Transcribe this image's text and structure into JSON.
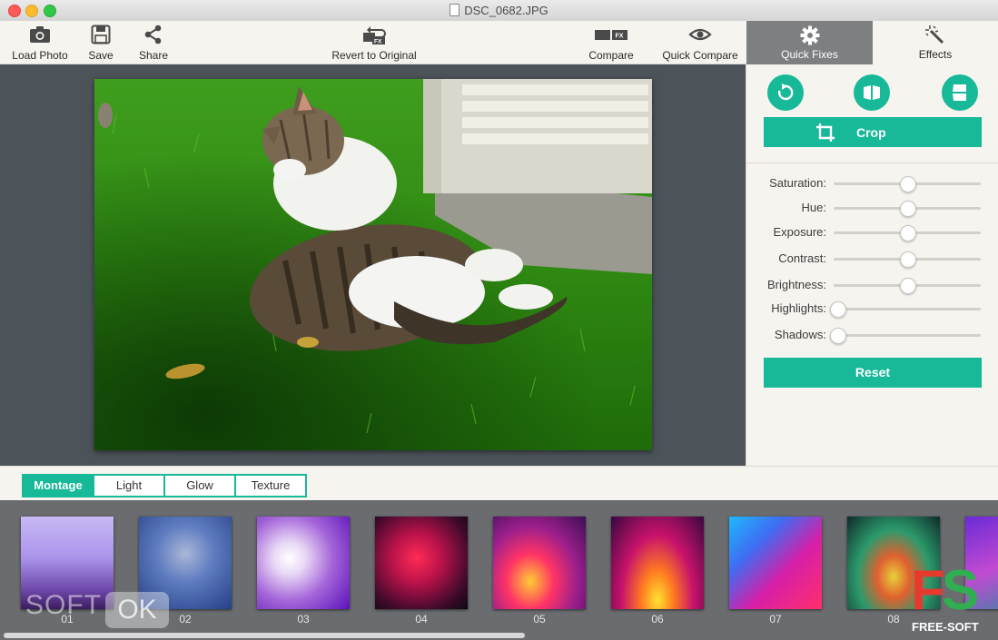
{
  "window": {
    "title": "DSC_0682.JPG"
  },
  "toolbar": {
    "load_photo": "Load Photo",
    "save": "Save",
    "share": "Share",
    "revert": "Revert to Original",
    "compare": "Compare",
    "quick_compare": "Quick Compare",
    "fx_badge": "FX"
  },
  "panel_tabs": {
    "quick_fixes": "Quick Fixes",
    "effects": "Effects"
  },
  "quick_fixes": {
    "crop": "Crop",
    "reset": "Reset",
    "sliders": [
      {
        "label": "Saturation:",
        "value": 0.5
      },
      {
        "label": "Hue:",
        "value": 0.5
      },
      {
        "label": "Exposure:",
        "value": 0.5
      },
      {
        "label": "Contrast:",
        "value": 0.5
      },
      {
        "label": "Brightness:",
        "value": 0.5
      },
      {
        "label": "Highlights:",
        "value": 0.0
      },
      {
        "label": "Shadows:",
        "value": 0.0
      }
    ]
  },
  "preset_tabs": {
    "montage": "Montage",
    "light": "Light",
    "glow": "Glow",
    "texture": "Texture",
    "active": "Montage"
  },
  "presets": [
    "01",
    "02",
    "03",
    "04",
    "05",
    "06",
    "07",
    "08"
  ],
  "watermarks": {
    "soft": "SOFT",
    "ok": "OK",
    "fs": "FS",
    "free_soft": "FREE-SOFT"
  },
  "colors": {
    "accent": "#17b999",
    "canvas_bg": "#4c545a",
    "selected_tab": "#7d7f81"
  }
}
